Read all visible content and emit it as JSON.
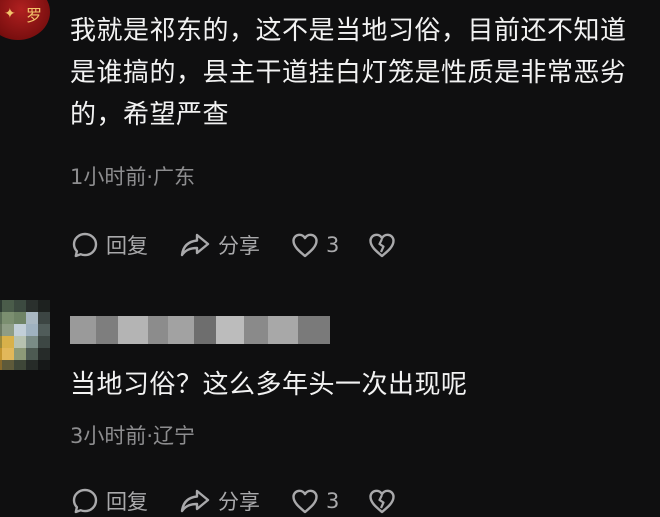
{
  "comments": [
    {
      "text": "我就是祁东的，这不是当地习俗，目前还不知道是谁搞的，县主干道挂白灯笼是性质是非常恶劣的，希望严查",
      "time": "1小时前",
      "location": "广东",
      "meta": "1小时前·广东",
      "reply_label": "回复",
      "share_label": "分享",
      "like_count": "3",
      "avatar_icon": "red-avatar-icon"
    },
    {
      "text": "当地习俗？这么多年头一次出现呢",
      "time": "3小时前",
      "location": "辽宁",
      "meta": "3小时前·辽宁",
      "reply_label": "回复",
      "share_label": "分享",
      "like_count": "3",
      "avatar_icon": "blurred-avatar-icon"
    }
  ],
  "avatar_glyph": "罗",
  "colors": {
    "background": "#0f0f10",
    "text": "#f2f2f2",
    "meta": "#8d8d8f",
    "actions": "#a9a9ab"
  }
}
